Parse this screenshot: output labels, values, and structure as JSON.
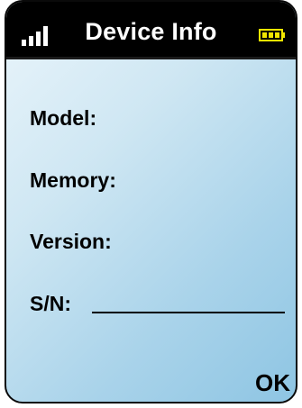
{
  "header": {
    "title": "Device Info",
    "signal_icon": "signal-bars-icon",
    "battery_icon": "battery-icon",
    "battery_color": "#f2e600"
  },
  "info": {
    "model_label": "Model:",
    "memory_label": "Memory:",
    "version_label": "Version:",
    "sn_label": "S/N:"
  },
  "softkey": {
    "ok_label": "OK"
  }
}
